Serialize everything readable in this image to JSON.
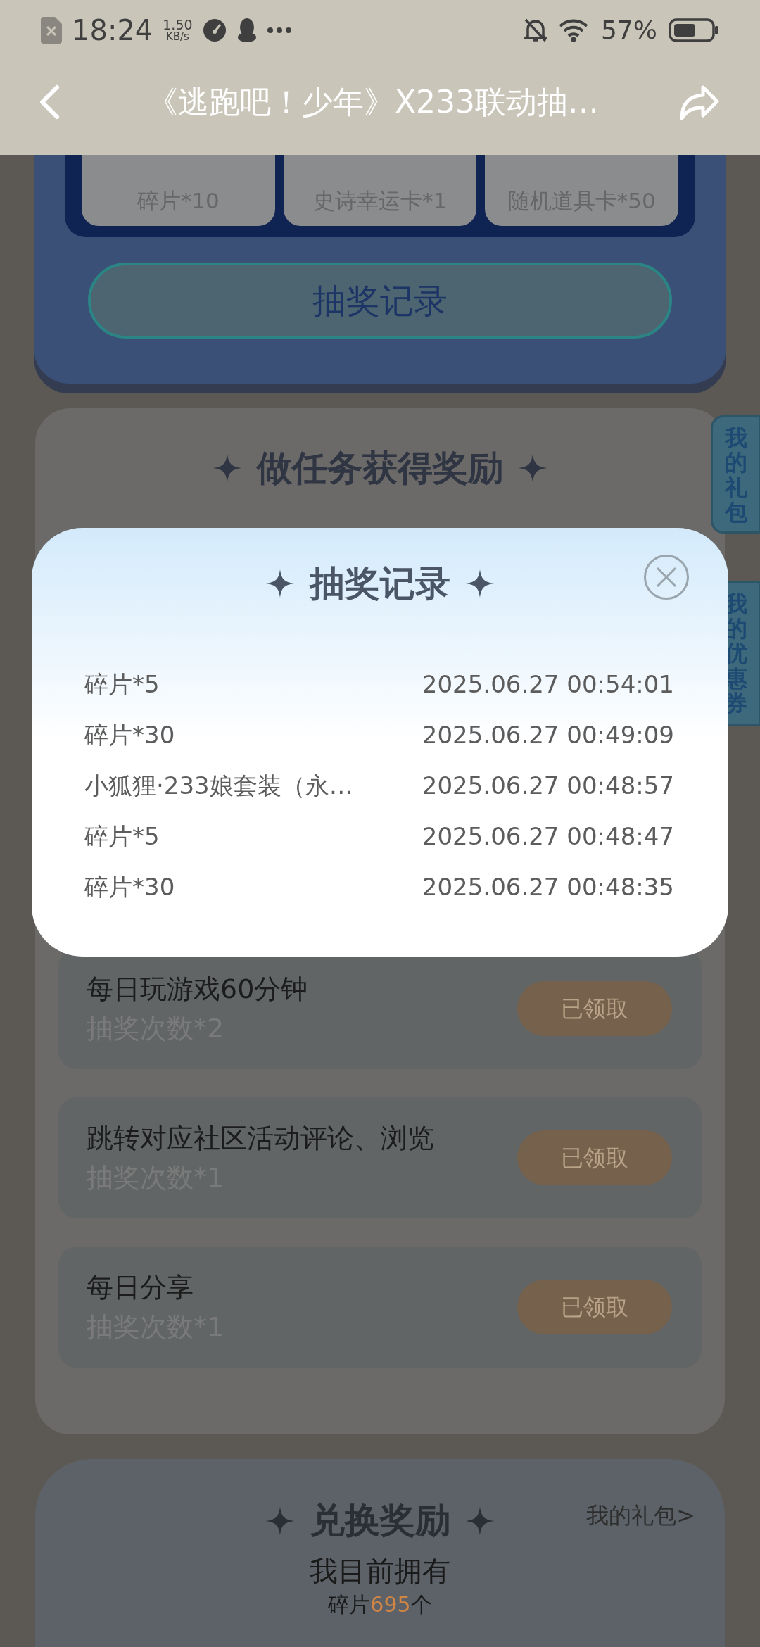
{
  "status_bar": {
    "time": "18:24",
    "net_speed": "1.50",
    "net_unit": "KB/s",
    "battery": "57%"
  },
  "header": {
    "title": "《逃跑吧！少年》X233联动抽…"
  },
  "prizes": [
    "碎片*10",
    "史诗幸运卡*1",
    "随机道具卡*50"
  ],
  "record_button": "抽奖记录",
  "tasks_section": {
    "title": "做任务获得奖励",
    "side_tabs": [
      "我的礼包",
      "我的优惠券"
    ],
    "tasks": [
      {
        "name": "每日玩游戏60分钟",
        "reward": "抽奖次数*2",
        "button": "已领取",
        "claimed": true
      },
      {
        "name": "跳转对应社区活动评论、浏览",
        "reward": "抽奖次数*1",
        "button": "已领取",
        "claimed": true
      },
      {
        "name": "每日分享",
        "reward": "抽奖次数*1",
        "button": "已领取",
        "claimed": true
      }
    ]
  },
  "exchange": {
    "title": "兑换奖励",
    "link": "我的礼包>",
    "owned_label": "我目前拥有",
    "count_prefix": "碎片",
    "count": "695",
    "count_suffix": "个"
  },
  "dialog": {
    "title": "抽奖记录",
    "records": [
      {
        "item": "碎片*5",
        "time": "2025.06.27 00:54:01"
      },
      {
        "item": "碎片*30",
        "time": "2025.06.27 00:49:09"
      },
      {
        "item": "小狐狸·233娘套装（永…",
        "time": "2025.06.27 00:48:57"
      },
      {
        "item": "碎片*5",
        "time": "2025.06.27 00:48:47"
      },
      {
        "item": "碎片*30",
        "time": "2025.06.27 00:48:35"
      }
    ]
  }
}
